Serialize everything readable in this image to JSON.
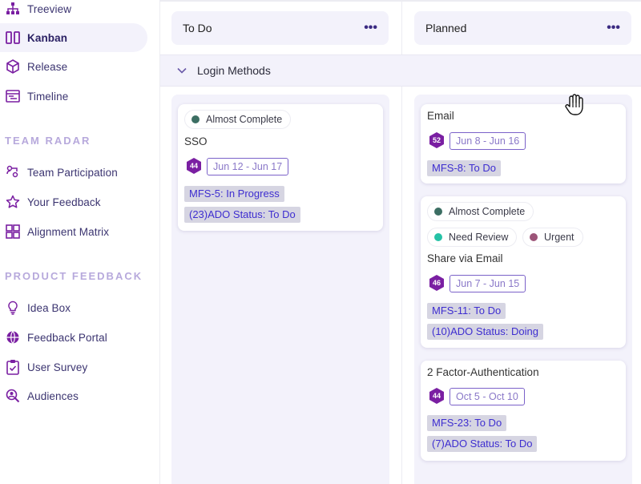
{
  "sidebar": {
    "items": [
      {
        "label": "Treeview",
        "icon": "treeview-icon"
      },
      {
        "label": "Kanban",
        "icon": "kanban-icon",
        "active": true
      },
      {
        "label": "Release",
        "icon": "release-icon"
      },
      {
        "label": "Timeline",
        "icon": "timeline-icon"
      }
    ],
    "team_radar": {
      "title": "TEAM RADAR",
      "items": [
        {
          "label": "Team Participation",
          "icon": "team-participation-icon"
        },
        {
          "label": "Your Feedback",
          "icon": "star-icon"
        },
        {
          "label": "Alignment Matrix",
          "icon": "grid-icon"
        }
      ]
    },
    "product_feedback": {
      "title": "PRODUCT FEEDBACK",
      "items": [
        {
          "label": "Idea Box",
          "icon": "lightbulb-icon"
        },
        {
          "label": "Feedback Portal",
          "icon": "globe-icon"
        },
        {
          "label": "User Survey",
          "icon": "clipboard-check-icon"
        },
        {
          "label": "Audiences",
          "icon": "audience-search-icon"
        }
      ]
    }
  },
  "board": {
    "columns": [
      {
        "title": "To Do",
        "more": "•••"
      },
      {
        "title": "Planned",
        "more": "•••"
      }
    ],
    "group": {
      "label": "Login Methods"
    },
    "cards": {
      "sso": {
        "tag": "Almost Complete",
        "title": "SSO",
        "badge": "44",
        "date": "Jun 12 - Jun 17",
        "chips": [
          "MFS-5: In Progress",
          "(23)ADO Status: To Do"
        ]
      },
      "email": {
        "title": "Email",
        "badge": "52",
        "date": "Jun 8 - Jun 16",
        "chips": [
          "MFS-8: To Do"
        ]
      },
      "share": {
        "tags": [
          "Almost Complete",
          "Need Review",
          "Urgent"
        ],
        "title": "Share via Email",
        "badge": "46",
        "date": "Jun 7 - Jun 15",
        "chips": [
          "MFS-11: To Do",
          "(10)ADO Status: Doing"
        ]
      },
      "twofa": {
        "title": "2 Factor-Authentication",
        "badge": "44",
        "date": "Oct 5 - Oct 10",
        "chips": [
          "MFS-23: To Do",
          "(7)ADO Status: To Do"
        ]
      }
    }
  },
  "colors": {
    "accent": "#7a1fa2",
    "almost_complete": "#3c6e63",
    "need_review": "#26c2a6",
    "urgent": "#9c5478",
    "chip_bg": "#d6d5e2",
    "chip_text": "#3e2ed0"
  }
}
